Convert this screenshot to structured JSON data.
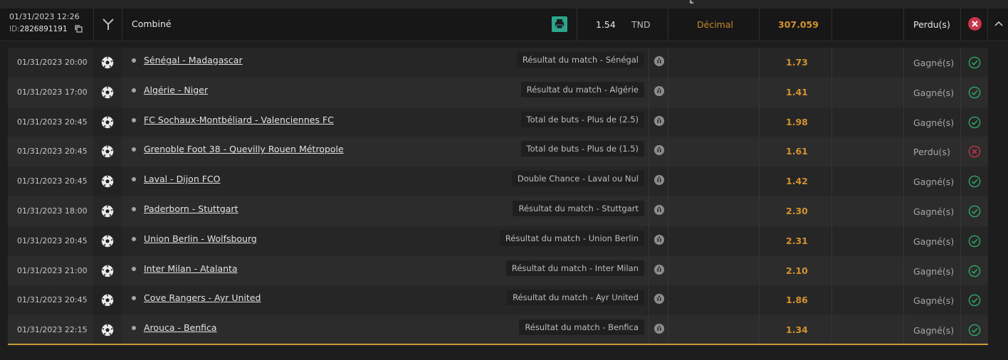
{
  "bet": {
    "datetime": "01/31/2023 12:26",
    "id_label": "ID:",
    "id": "2826891191",
    "type": "Combiné",
    "stake": "1.54",
    "currency": "TND",
    "odds_format": "Décimal",
    "potential_gain": "307.059",
    "status": "Perdu(s)"
  },
  "colors": {
    "win": "#2fa868",
    "loss": "#c7354b",
    "odds": "#d4922f",
    "print_button": "#2ca58d"
  },
  "selections": [
    {
      "date": "01/31/2023 20:00",
      "match": "Sénégal - Madagascar",
      "market": "Résultat du match - Sénégal",
      "odds": "1.73",
      "status": "Gagné(s)",
      "result": "won"
    },
    {
      "date": "01/31/2023 17:00",
      "match": "Algérie - Niger",
      "market": "Résultat du match - Algérie",
      "odds": "1.41",
      "status": "Gagné(s)",
      "result": "won"
    },
    {
      "date": "01/31/2023 20:45",
      "match": "FC Sochaux-Montbéliard - Valenciennes FC",
      "market": "Total de buts - Plus de (2.5)",
      "odds": "1.98",
      "status": "Gagné(s)",
      "result": "won"
    },
    {
      "date": "01/31/2023 20:45",
      "match": "Grenoble Foot 38 - Quevilly Rouen Métropole",
      "market": "Total de buts - Plus de (1.5)",
      "odds": "1.61",
      "status": "Perdu(s)",
      "result": "lost"
    },
    {
      "date": "01/31/2023 20:45",
      "match": "Laval - Dijon FCO",
      "market": "Double Chance - Laval ou Nul",
      "odds": "1.42",
      "status": "Gagné(s)",
      "result": "won"
    },
    {
      "date": "01/31/2023 18:00",
      "match": "Paderborn - Stuttgart",
      "market": "Résultat du match - Stuttgart",
      "odds": "2.30",
      "status": "Gagné(s)",
      "result": "won"
    },
    {
      "date": "01/31/2023 20:45",
      "match": "Union Berlin - Wolfsbourg",
      "market": "Résultat du match - Union Berlin",
      "odds": "2.31",
      "status": "Gagné(s)",
      "result": "won"
    },
    {
      "date": "01/31/2023 21:00",
      "match": "Inter Milan - Atalanta",
      "market": "Résultat du match - Inter Milan",
      "odds": "2.10",
      "status": "Gagné(s)",
      "result": "won"
    },
    {
      "date": "01/31/2023 20:45",
      "match": "Cove Rangers - Ayr United",
      "market": "Résultat du match - Ayr United",
      "odds": "1.86",
      "status": "Gagné(s)",
      "result": "won"
    },
    {
      "date": "01/31/2023 22:15",
      "match": "Arouca - Benfica",
      "market": "Résultat du match - Benfica",
      "odds": "1.34",
      "status": "Gagné(s)",
      "result": "won"
    }
  ]
}
